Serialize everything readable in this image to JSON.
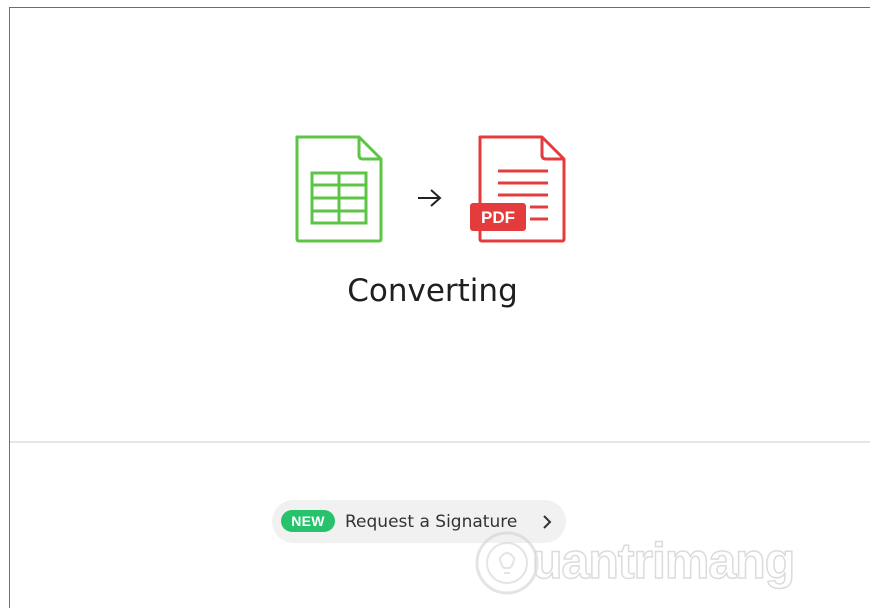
{
  "conversion": {
    "source_icon": "spreadsheet-file-icon",
    "arrow_icon": "arrow-right-icon",
    "target_icon": "pdf-file-icon",
    "target_badge": "PDF",
    "status": "Converting"
  },
  "promo": {
    "badge": "NEW",
    "label": "Request a Signature",
    "chevron_icon": "chevron-right-icon"
  },
  "watermark": {
    "text": "uantrimang"
  },
  "colors": {
    "sheet_green": "#5cc545",
    "pdf_red": "#e43c3c",
    "new_badge": "#27c26c",
    "pill_bg": "#f1f1f1"
  }
}
